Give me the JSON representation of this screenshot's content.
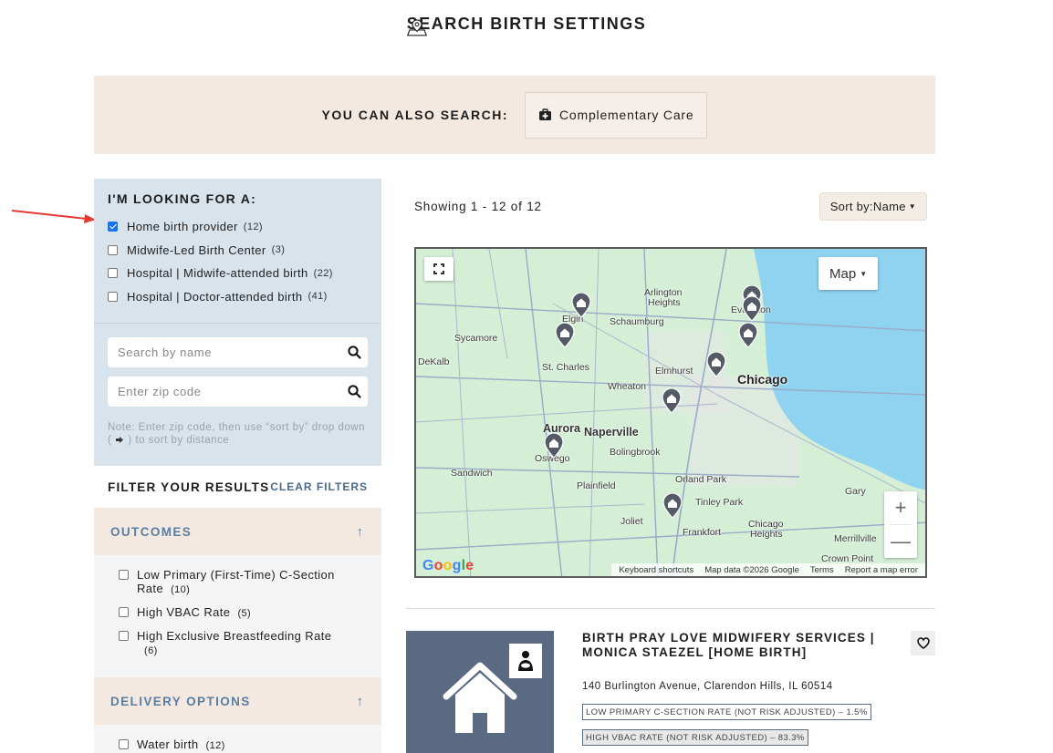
{
  "header": {
    "title": "SEARCH BIRTH SETTINGS"
  },
  "also_search": {
    "label": "YOU CAN ALSO SEARCH:",
    "button_label": "Complementary Care"
  },
  "looking_for": {
    "heading": "I'M LOOKING FOR A:",
    "options": [
      {
        "label": "Home birth provider",
        "count": "(12)",
        "checked": true
      },
      {
        "label": "Midwife-Led Birth Center",
        "count": "(3)",
        "checked": false
      },
      {
        "label": "Hospital | Midwife-attended birth",
        "count": "(22)",
        "checked": false
      },
      {
        "label": "Hospital | Doctor-attended birth",
        "count": "(41)",
        "checked": false
      }
    ]
  },
  "search": {
    "name_placeholder": "Search by name",
    "zip_placeholder": "Enter zip code",
    "note_before": "Note: Enter zip code, then use “sort by” drop down (",
    "note_after": ") to sort by distance"
  },
  "filters": {
    "heading": "FILTER YOUR RESULTS",
    "clear_label": "CLEAR FILTERS",
    "outcomes": {
      "heading": "OUTCOMES",
      "items": [
        {
          "label": "Low Primary (First-Time) C-Section Rate",
          "count": "(10)"
        },
        {
          "label": "High VBAC Rate",
          "count": "(5)"
        },
        {
          "label": "High Exclusive Breastfeeding Rate",
          "count": "(6)"
        }
      ]
    },
    "delivery": {
      "heading": "DELIVERY OPTIONS",
      "items": [
        {
          "label": "Water birth",
          "count": "(12)"
        }
      ]
    }
  },
  "results": {
    "showing": "Showing 1 - 12 of 12",
    "sort_label": "Sort by:",
    "sort_value": "Name"
  },
  "map": {
    "type_label": "Map",
    "labels": {
      "arlington": "Arlington",
      "heights": "Heights",
      "elgin": "Elgin",
      "schaumburg": "Schaumburg",
      "evanston": "Evanston",
      "sycamore": "Sycamore",
      "dekalb": "DeKalb",
      "stcharles": "St. Charles",
      "elmhurst": "Elmhurst",
      "chicago": "Chicago",
      "wheaton": "Wheaton",
      "aurora": "Aurora",
      "naperville": "Naperville",
      "oswego": "Oswego",
      "bolingbrook": "Bolingbrook",
      "sandwich": "Sandwich",
      "plainfield": "Plainfield",
      "orlandpark": "Orland Park",
      "gary": "Gary",
      "tinleypark": "Tinley Park",
      "joliet": "Joliet",
      "frankfort": "Frankfort",
      "chicagoheights1": "Chicago",
      "chicagoheights2": "Heights",
      "merrillville": "Merrillville",
      "crownpoint": "Crown Point"
    },
    "google": "Google",
    "footer": {
      "shortcuts": "Keyboard shortcuts",
      "data": "Map data ©2026 Google",
      "terms": "Terms",
      "report": "Report a map error"
    },
    "colors": {
      "water": "#8fd3f0",
      "land": "#d5efd6",
      "pin": "#555b66"
    }
  },
  "listing": {
    "name": "BIRTH PRAY LOVE MIDWIFERY SERVICES | MONICA STAEZEL [HOME BIRTH]",
    "address": "140 Burlington Avenue, Clarendon Hills, IL 60514",
    "tag1": "LOW PRIMARY C-SECTION RATE (NOT RISK ADJUSTED) – 1.5%",
    "tag2": "HIGH VBAC RATE (NOT RISK ADJUSTED) – 83.3%"
  }
}
